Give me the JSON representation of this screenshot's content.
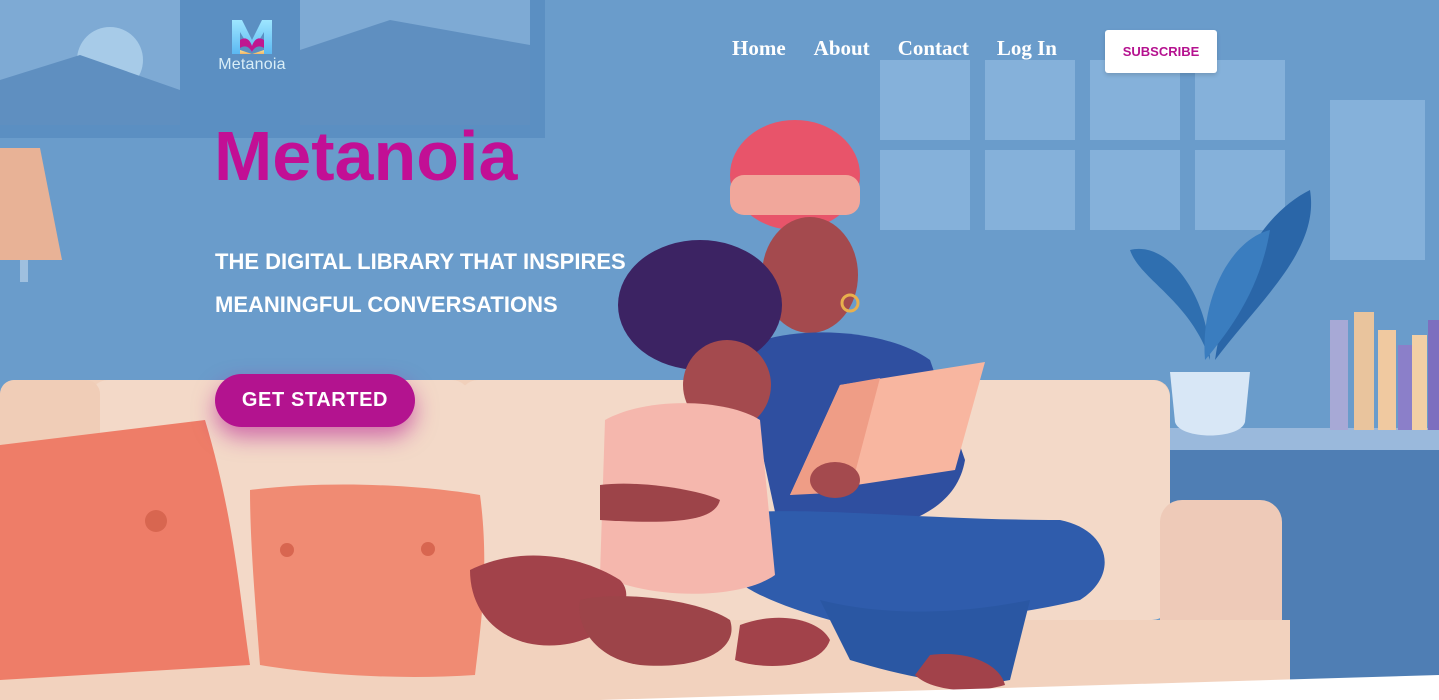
{
  "brand": {
    "name": "Metanoia",
    "logo_icon": "book-m-logo-icon"
  },
  "nav": {
    "links": [
      "Home",
      "About",
      "Contact",
      "Log In"
    ],
    "subscribe_label": "SUBSCRIBE"
  },
  "hero": {
    "title": "Metanoia",
    "subtitle": "THE DIGITAL LIBRARY THAT INSPIRES MEANINGFUL CONVERSATIONS",
    "cta_label": "GET STARTED"
  },
  "colors": {
    "accent": "#c20f95",
    "button": "#b3138f",
    "background": "#6a9ccb",
    "nav_text": "#ffffff"
  }
}
